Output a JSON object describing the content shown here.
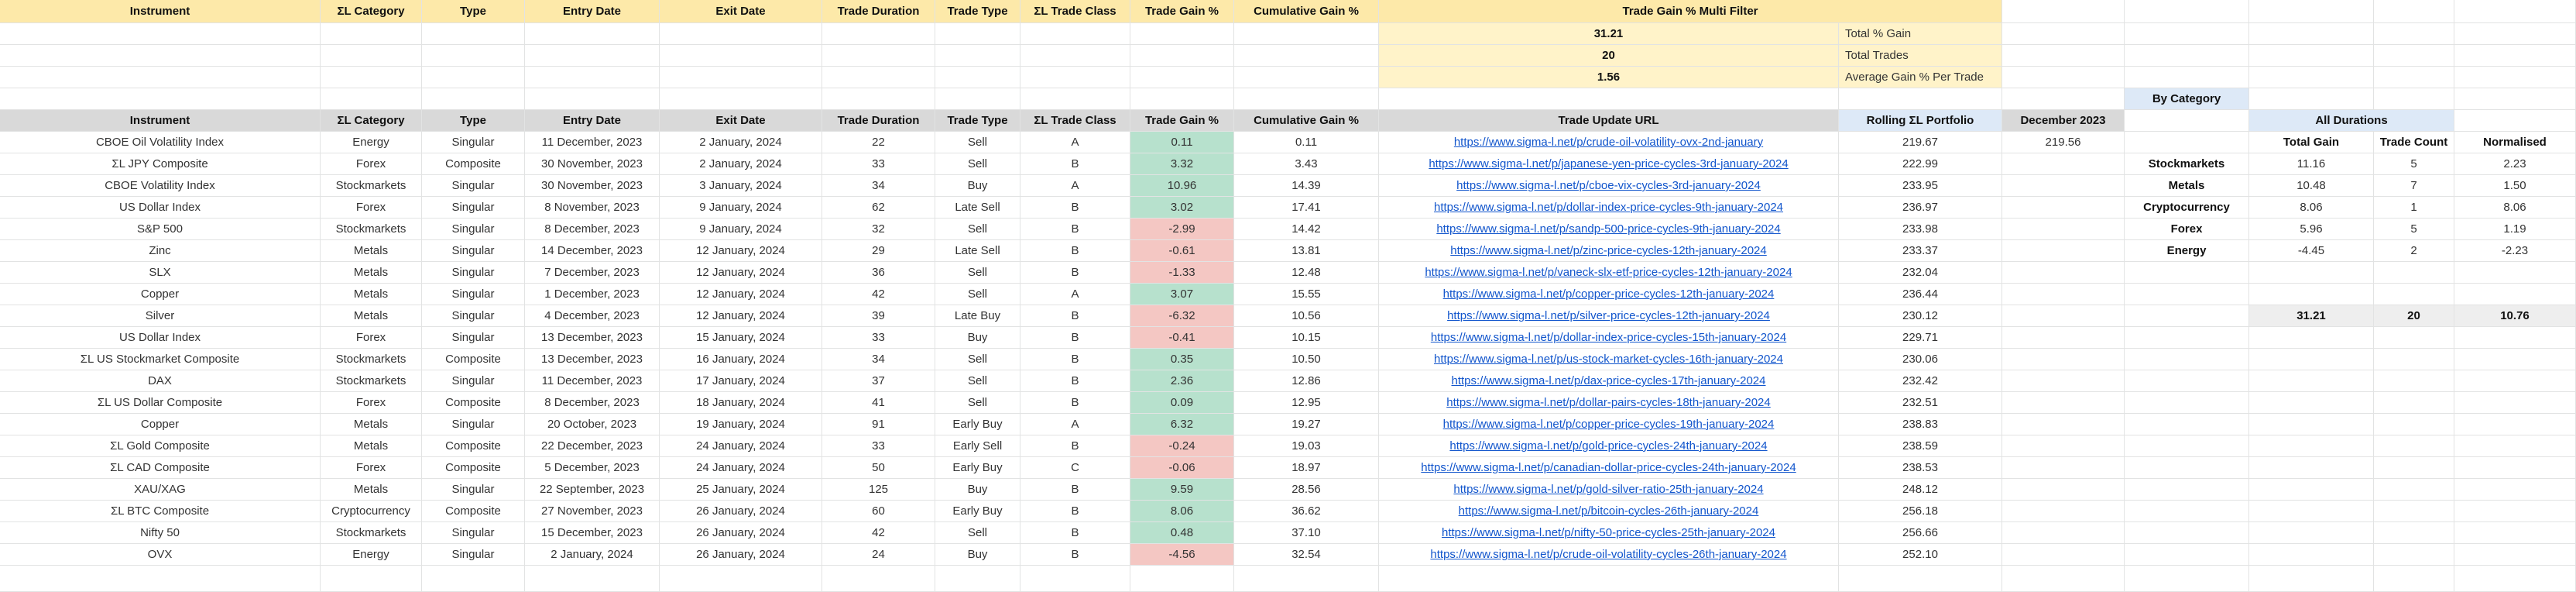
{
  "top_headers": [
    "Instrument",
    "ΣL Category",
    "Type",
    "Entry Date",
    "Exit Date",
    "Trade Duration",
    "Trade Type",
    "ΣL Trade Class",
    "Trade Gain %",
    "Cumulative Gain %",
    "Trade Gain % Multi Filter"
  ],
  "summary": [
    {
      "value": "31.21",
      "label": "Total % Gain"
    },
    {
      "value": "20",
      "label": "Total Trades"
    },
    {
      "value": "1.56",
      "label": "Average Gain % Per Trade"
    }
  ],
  "table_headers": [
    "Instrument",
    "ΣL Category",
    "Type",
    "Entry Date",
    "Exit Date",
    "Trade Duration",
    "Trade Type",
    "ΣL Trade Class",
    "Trade Gain %",
    "Cumulative Gain %",
    "Trade Update URL",
    "Rolling ΣL Portfolio",
    "December 2023"
  ],
  "first_row_december": "219.56",
  "rows": [
    [
      "CBOE Oil Volatility Index",
      "Energy",
      "Singular",
      "11 December, 2023",
      "2 January, 2024",
      "22",
      "Sell",
      "A",
      "0.11",
      "0.11",
      "https://www.sigma-l.net/p/crude-oil-volatility-ovx-2nd-january",
      "219.67"
    ],
    [
      "ΣL JPY Composite",
      "Forex",
      "Composite",
      "30 November, 2023",
      "2 January, 2024",
      "33",
      "Sell",
      "B",
      "3.32",
      "3.43",
      "https://www.sigma-l.net/p/japanese-yen-price-cycles-3rd-january-2024",
      "222.99"
    ],
    [
      "CBOE Volatility Index",
      "Stockmarkets",
      "Singular",
      "30 November, 2023",
      "3 January, 2024",
      "34",
      "Buy",
      "A",
      "10.96",
      "14.39",
      "https://www.sigma-l.net/p/cboe-vix-cycles-3rd-january-2024",
      "233.95"
    ],
    [
      "US Dollar Index",
      "Forex",
      "Singular",
      "8 November, 2023",
      "9 January, 2024",
      "62",
      "Late Sell",
      "B",
      "3.02",
      "17.41",
      "https://www.sigma-l.net/p/dollar-index-price-cycles-9th-january-2024",
      "236.97"
    ],
    [
      "S&P 500",
      "Stockmarkets",
      "Singular",
      "8 December, 2023",
      "9 January, 2024",
      "32",
      "Sell",
      "B",
      "-2.99",
      "14.42",
      "https://www.sigma-l.net/p/sandp-500-price-cycles-9th-january-2024",
      "233.98"
    ],
    [
      "Zinc",
      "Metals",
      "Singular",
      "14 December, 2023",
      "12 January, 2024",
      "29",
      "Late Sell",
      "B",
      "-0.61",
      "13.81",
      "https://www.sigma-l.net/p/zinc-price-cycles-12th-january-2024",
      "233.37"
    ],
    [
      "SLX",
      "Metals",
      "Singular",
      "7 December, 2023",
      "12 January, 2024",
      "36",
      "Sell",
      "B",
      "-1.33",
      "12.48",
      "https://www.sigma-l.net/p/vaneck-slx-etf-price-cycles-12th-january-2024",
      "232.04"
    ],
    [
      "Copper",
      "Metals",
      "Singular",
      "1 December, 2023",
      "12 January, 2024",
      "42",
      "Sell",
      "A",
      "3.07",
      "15.55",
      "https://www.sigma-l.net/p/copper-price-cycles-12th-january-2024",
      "236.44"
    ],
    [
      "Silver",
      "Metals",
      "Singular",
      "4 December, 2023",
      "12 January, 2024",
      "39",
      "Late Buy",
      "B",
      "-6.32",
      "10.56",
      "https://www.sigma-l.net/p/silver-price-cycles-12th-january-2024",
      "230.12"
    ],
    [
      "US Dollar Index",
      "Forex",
      "Singular",
      "13 December, 2023",
      "15 January, 2024",
      "33",
      "Buy",
      "B",
      "-0.41",
      "10.15",
      "https://www.sigma-l.net/p/dollar-index-price-cycles-15th-january-2024",
      "229.71"
    ],
    [
      "ΣL US Stockmarket Composite",
      "Stockmarkets",
      "Composite",
      "13 December, 2023",
      "16 January, 2024",
      "34",
      "Sell",
      "B",
      "0.35",
      "10.50",
      "https://www.sigma-l.net/p/us-stock-market-cycles-16th-january-2024",
      "230.06"
    ],
    [
      "DAX",
      "Stockmarkets",
      "Singular",
      "11 December, 2023",
      "17 January, 2024",
      "37",
      "Sell",
      "B",
      "2.36",
      "12.86",
      "https://www.sigma-l.net/p/dax-price-cycles-17th-january-2024",
      "232.42"
    ],
    [
      "ΣL US Dollar Composite",
      "Forex",
      "Composite",
      "8 December, 2023",
      "18 January, 2024",
      "41",
      "Sell",
      "B",
      "0.09",
      "12.95",
      "https://www.sigma-l.net/p/dollar-pairs-cycles-18th-january-2024",
      "232.51"
    ],
    [
      "Copper",
      "Metals",
      "Singular",
      "20 October, 2023",
      "19 January, 2024",
      "91",
      "Early Buy",
      "A",
      "6.32",
      "19.27",
      "https://www.sigma-l.net/p/copper-price-cycles-19th-january-2024",
      "238.83"
    ],
    [
      "ΣL Gold Composite",
      "Metals",
      "Composite",
      "22 December, 2023",
      "24 January, 2024",
      "33",
      "Early Sell",
      "B",
      "-0.24",
      "19.03",
      "https://www.sigma-l.net/p/gold-price-cycles-24th-january-2024",
      "238.59"
    ],
    [
      "ΣL CAD Composite",
      "Forex",
      "Composite",
      "5 December, 2023",
      "24 January, 2024",
      "50",
      "Early Buy",
      "C",
      "-0.06",
      "18.97",
      "https://www.sigma-l.net/p/canadian-dollar-price-cycles-24th-january-2024",
      "238.53"
    ],
    [
      "XAU/XAG",
      "Metals",
      "Singular",
      "22 September, 2023",
      "25 January, 2024",
      "125",
      "Buy",
      "B",
      "9.59",
      "28.56",
      "https://www.sigma-l.net/p/gold-silver-ratio-25th-january-2024",
      "248.12"
    ],
    [
      "ΣL BTC Composite",
      "Cryptocurrency",
      "Composite",
      "27 November, 2023",
      "26 January, 2024",
      "60",
      "Early Buy",
      "B",
      "8.06",
      "36.62",
      "https://www.sigma-l.net/p/bitcoin-cycles-26th-january-2024",
      "256.18"
    ],
    [
      "Nifty 50",
      "Stockmarkets",
      "Singular",
      "15 December, 2023",
      "26 January, 2024",
      "42",
      "Sell",
      "B",
      "0.48",
      "37.10",
      "https://www.sigma-l.net/p/nifty-50-price-cycles-25th-january-2024",
      "256.66"
    ],
    [
      "OVX",
      "Energy",
      "Singular",
      "2 January, 2024",
      "26 January, 2024",
      "24",
      "Buy",
      "B",
      "-4.56",
      "32.54",
      "https://www.sigma-l.net/p/crude-oil-volatility-cycles-26th-january-2024",
      "252.10"
    ]
  ],
  "by_category": {
    "title": "By Category",
    "subtitle": "All Durations",
    "headers": [
      "Total Gain",
      "Trade Count",
      "Normalised"
    ],
    "rows": [
      [
        "Stockmarkets",
        "11.16",
        "5",
        "2.23"
      ],
      [
        "Metals",
        "10.48",
        "7",
        "1.50"
      ],
      [
        "Cryptocurrency",
        "8.06",
        "1",
        "8.06"
      ],
      [
        "Forex",
        "5.96",
        "5",
        "1.19"
      ],
      [
        "Energy",
        "-4.45",
        "2",
        "-2.23"
      ]
    ],
    "totals": [
      "31.21",
      "20",
      "10.76"
    ]
  },
  "colors": {
    "header_gray": "#d9d9d9",
    "header_yellow": "#fde9a9",
    "summary_yellow": "#fff3c9",
    "portfolio_blue": "#dde9f7",
    "gain_green": "#b7e1cd",
    "loss_red": "#f4c7c3",
    "link": "#1155cc"
  }
}
